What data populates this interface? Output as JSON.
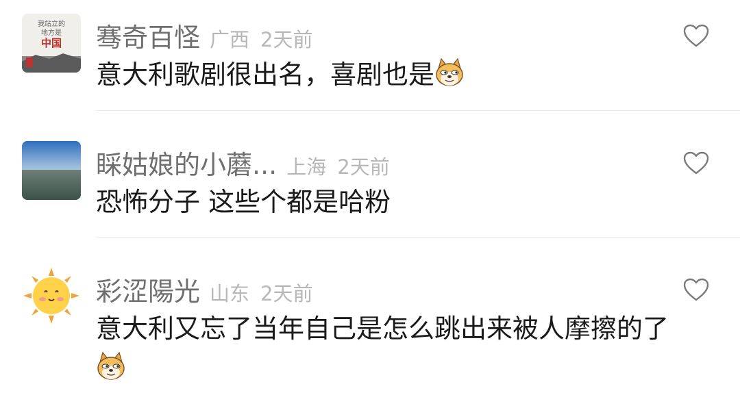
{
  "comments": [
    {
      "username": "骞奇百怪",
      "location": "广西",
      "time": "2天前",
      "text": "意大利歌剧很出名，喜剧也是",
      "avatar_text": [
        "我站立的",
        "地方是",
        "中国"
      ],
      "emoji": "doge"
    },
    {
      "username": "睬姑娘的小蘑...",
      "location": "上海",
      "time": "2天前",
      "text": "恐怖分子 这些个都是哈粉",
      "emoji": ""
    },
    {
      "username": "彩涩陽光",
      "location": "山东",
      "time": "2天前",
      "text": "意大利又忘了当年自己是怎么跳出来被人摩擦的了",
      "emoji": "doge"
    }
  ],
  "icons": {
    "like": "heart-outline-icon",
    "emoji": "doge-emoji-icon"
  },
  "colors": {
    "username": "#6f6f6f",
    "meta": "#b7b7b7",
    "text": "#1a1a1a",
    "divider": "#ebebeb"
  }
}
